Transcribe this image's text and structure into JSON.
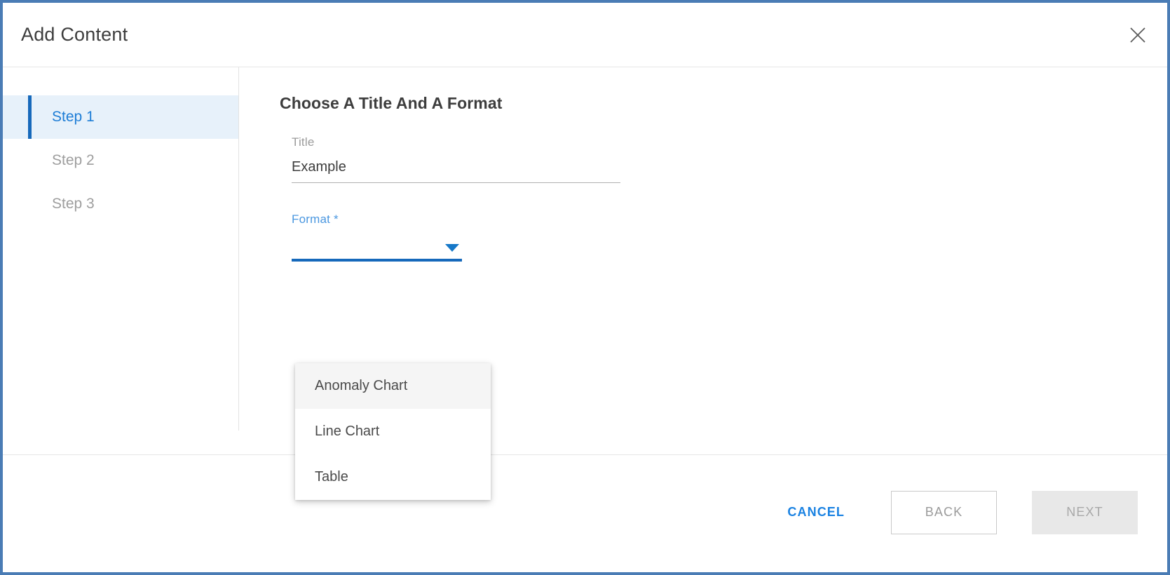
{
  "dialog": {
    "title": "Add Content",
    "close_icon": "close-icon"
  },
  "stepper": {
    "steps": [
      {
        "label": "Step 1",
        "active": true
      },
      {
        "label": "Step 2",
        "active": false
      },
      {
        "label": "Step 3",
        "active": false
      }
    ]
  },
  "form": {
    "heading": "Choose A Title And A Format",
    "title_field": {
      "label": "Title",
      "value": "Example",
      "placeholder": ""
    },
    "format_field": {
      "label": "Format *",
      "value": "",
      "caret_icon": "chevron-down-icon",
      "options": [
        {
          "label": "Anomaly Chart",
          "hovered": true
        },
        {
          "label": "Line Chart",
          "hovered": false
        },
        {
          "label": "Table",
          "hovered": false
        }
      ]
    }
  },
  "footer": {
    "cancel_label": "CANCEL",
    "back_label": "BACK",
    "next_label": "NEXT"
  },
  "colors": {
    "accent": "#1669bb",
    "link": "#1a82e2",
    "active_step_bg": "#e7f1fa",
    "window_border": "#4a7cb5"
  }
}
